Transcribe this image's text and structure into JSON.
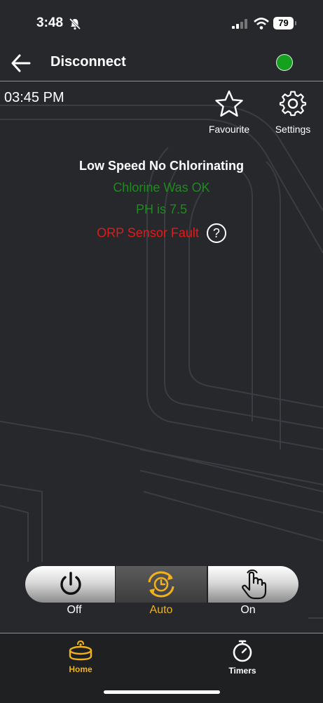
{
  "status_bar": {
    "time": "3:48",
    "battery": "79"
  },
  "nav": {
    "title": "Disconnect",
    "connection_color": "#14a11d"
  },
  "toolbar": {
    "clock": "03:45 PM",
    "favourite_label": "Favourite",
    "settings_label": "Settings"
  },
  "status": {
    "main": "Low Speed No Chlorinating",
    "chlorine": "Chlorine Was OK",
    "ph": "PH is 7.5",
    "orp": "ORP Sensor Fault",
    "help": "?"
  },
  "modes": {
    "selected": "Auto",
    "off_label": "Off",
    "auto_label": "Auto",
    "on_label": "On"
  },
  "tabs": {
    "home": "Home",
    "timers": "Timers",
    "active": "Home"
  },
  "colors": {
    "background": "#26282b",
    "accent": "#f2b21c",
    "ok": "#1f8a1f",
    "fault": "#e01b1b"
  }
}
